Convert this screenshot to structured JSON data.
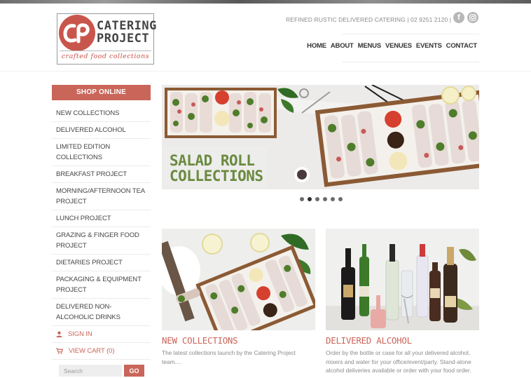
{
  "header": {
    "logo_name_line1": "CATERING",
    "logo_name_line2": "PROJECT",
    "logo_tagline": "crafted food collections",
    "tagline": "REFINED RUSTIC DELIVERED CATERING | 02 9251 2120 |",
    "social": [
      {
        "name": "facebook",
        "icon": "facebook-icon",
        "glyph": "f"
      },
      {
        "name": "instagram",
        "icon": "instagram-icon"
      }
    ],
    "nav": [
      "HOME",
      "ABOUT",
      "MENUS",
      "VENUES",
      "EVENTS",
      "CONTACT"
    ]
  },
  "sidebar": {
    "shop_online": "SHOP ONLINE",
    "items": [
      "NEW COLLECTIONS",
      "DELIVERED ALCOHOL",
      "LIMITED EDITION COLLECTIONS",
      "BREAKFAST PROJECT",
      "MORNING/AFTERNOON TEA PROJECT",
      "LUNCH PROJECT",
      "GRAZING & FINGER FOOD PROJECT",
      "DIETARIES PROJECT",
      "PACKAGING & EQUIPMENT PROJECT",
      "DELIVERED NON-ALCOHOLIC DRINKS"
    ],
    "sign_in": "SIGN IN",
    "view_cart": "VIEW CART (0)",
    "search_placeholder": "Search",
    "go_label": "GO"
  },
  "hero": {
    "line1": "SALAD ROLL",
    "line2": "COLLECTIONS",
    "slide_count": 6,
    "active_slide": 2
  },
  "cards": [
    {
      "title": "NEW COLLECTIONS",
      "description": "The latest collections launch by the Catering Project team...."
    },
    {
      "title": "DELIVERED ALCOHOL",
      "description": "Order by the bottle or case for all your delivered alcohol, mixers and water for your office/event/party. Stand-alone alcohol deliveries available or order with your food order."
    }
  ],
  "colors": {
    "accent": "#c96559",
    "hero_text": "#6b8a3f",
    "logo_red": "#c9564c"
  }
}
